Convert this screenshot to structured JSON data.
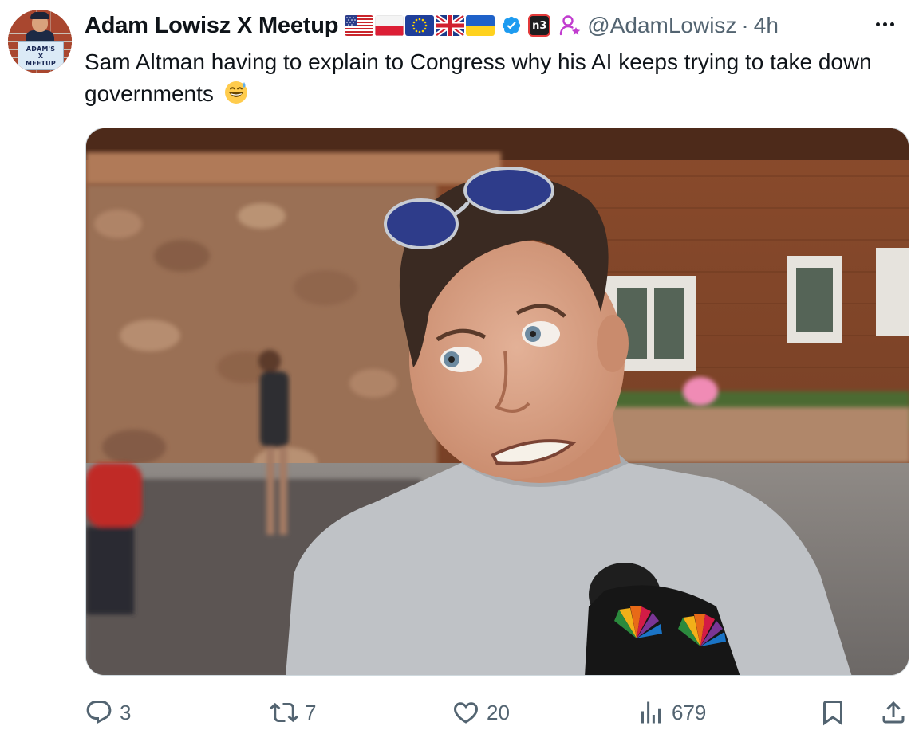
{
  "post": {
    "author_name": "Adam Lowisz X Meetup",
    "handle": "@AdamLowisz",
    "separator": "·",
    "time": "4h",
    "affiliate_badge": "n3",
    "text": "Sam Altman having to explain to Congress why his AI keeps trying to take down governments",
    "emoji": "grinning-face-with-sweat",
    "avatar_sign": [
      "ADAM'S",
      "X",
      "MEETUP"
    ],
    "flags": [
      "us-flag",
      "poland-flag",
      "eu-flag",
      "uk-flag",
      "ukraine-flag"
    ],
    "verified_color": "#1d9bf0"
  },
  "metrics": {
    "replies": "3",
    "reposts": "7",
    "likes": "20",
    "views": "679"
  },
  "icons": {
    "reply": "reply-icon",
    "repost": "repost-icon",
    "like": "heart-icon",
    "views": "views-icon",
    "bookmark": "bookmark-icon",
    "share": "share-icon",
    "more": "more-icon"
  }
}
